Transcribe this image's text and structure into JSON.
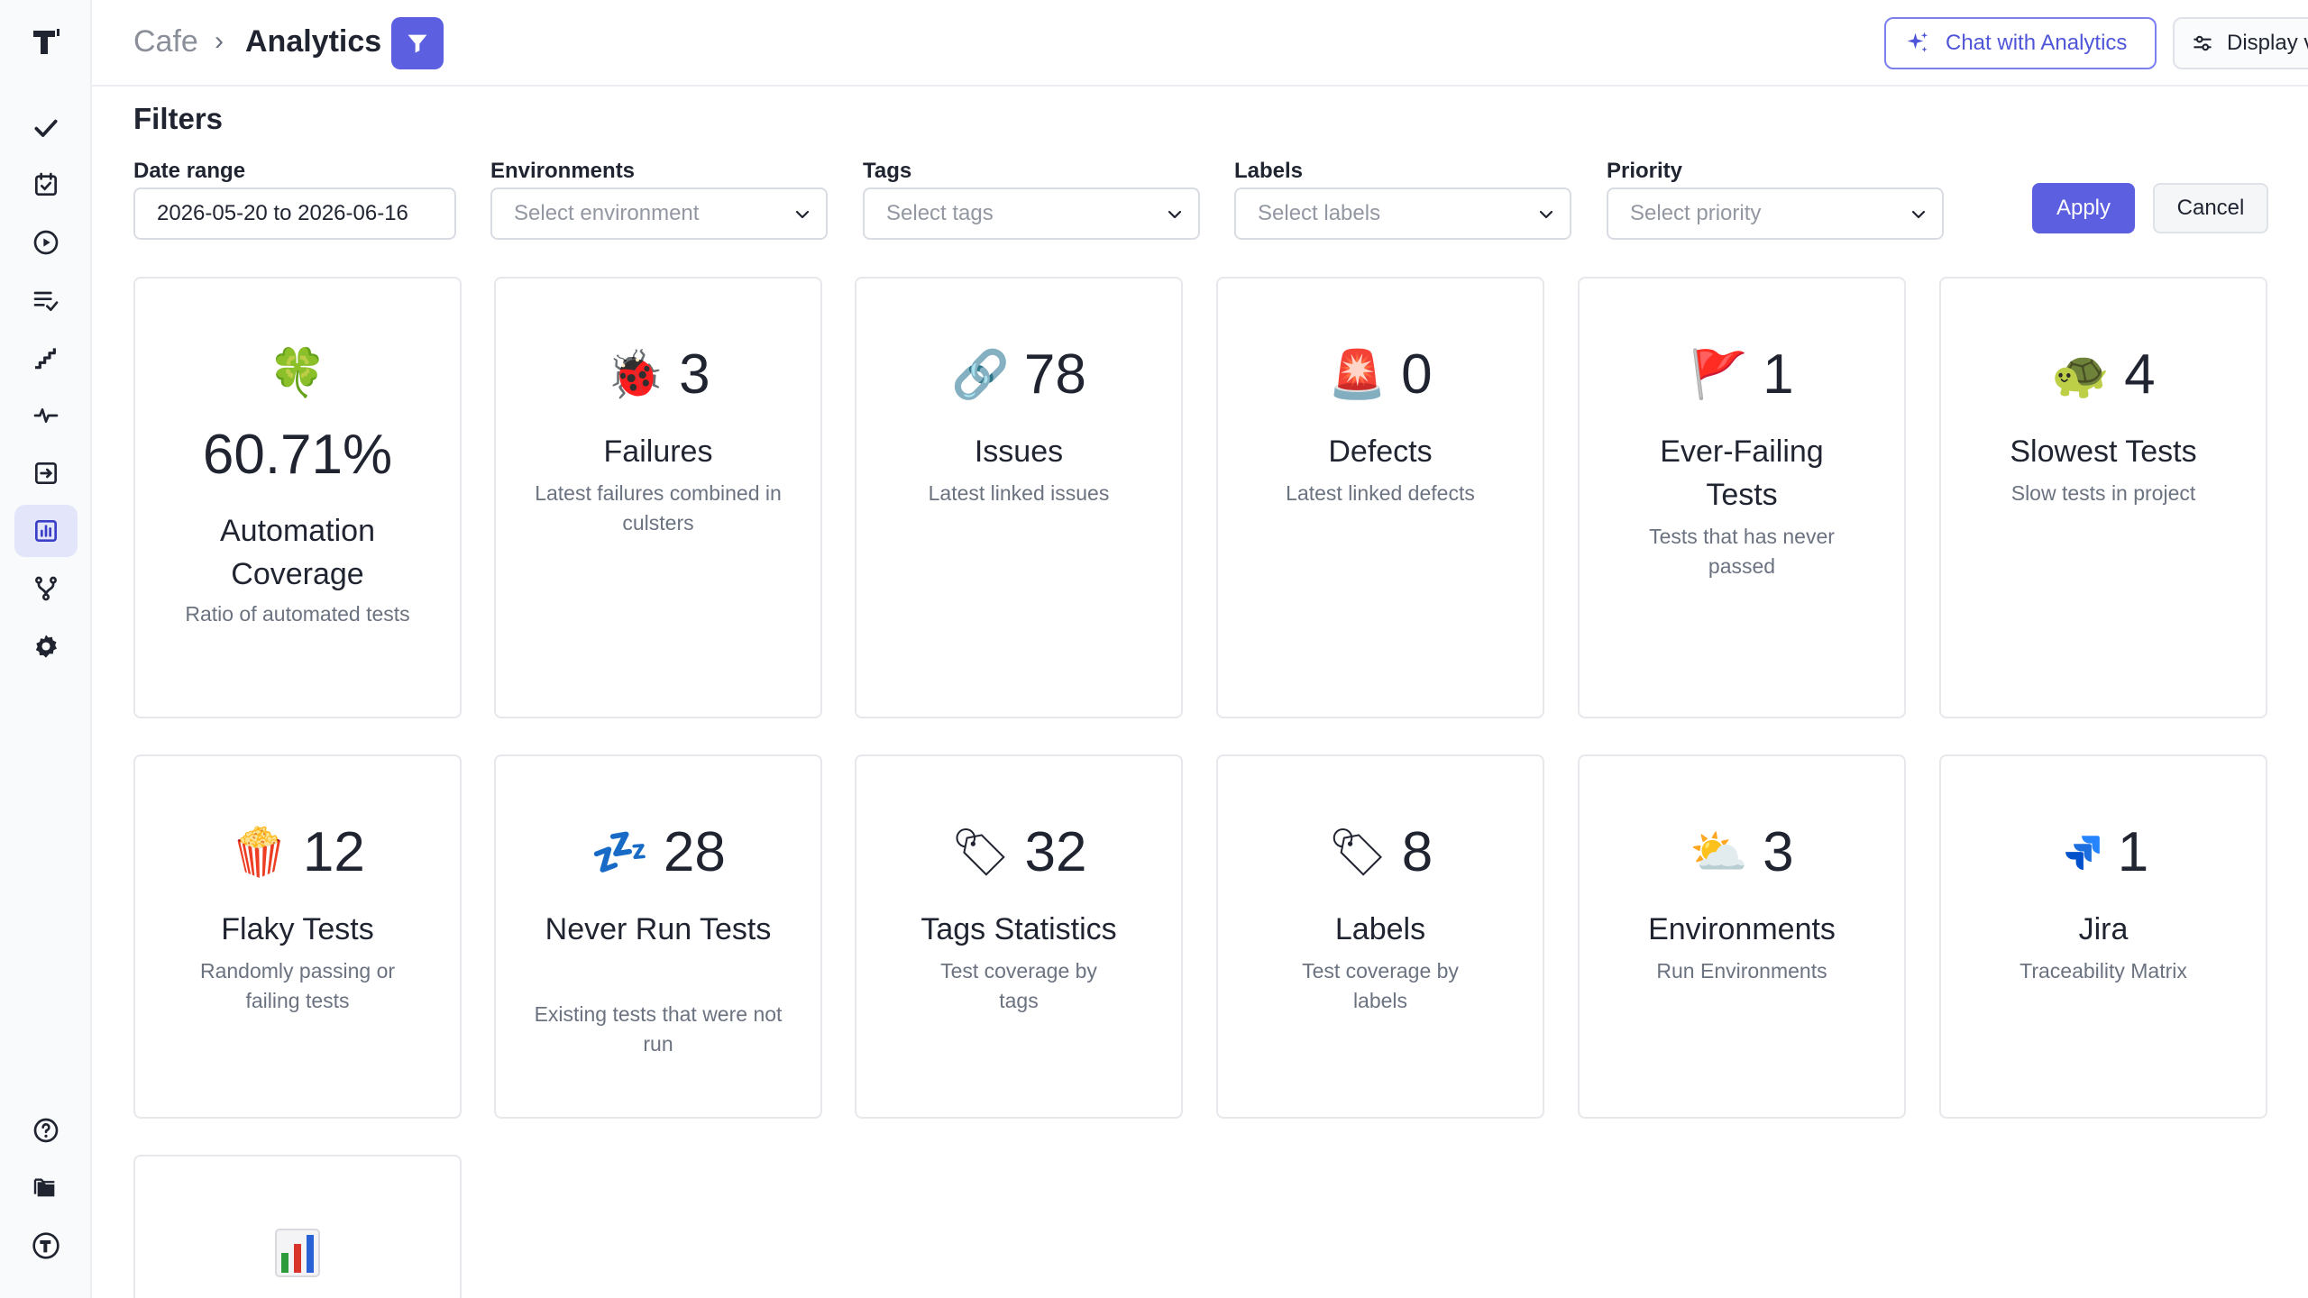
{
  "breadcrumb": {
    "project": "Cafe",
    "separator": "›",
    "page": "Analytics"
  },
  "header": {
    "chat_label": "Chat with Analytics",
    "display_label": "Display view"
  },
  "filters": {
    "title": "Filters",
    "date_range": {
      "label": "Date range",
      "value": "2026-05-20 to 2026-06-16"
    },
    "environments": {
      "label": "Environments",
      "placeholder": "Select environment"
    },
    "tags": {
      "label": "Tags",
      "placeholder": "Select tags"
    },
    "labels": {
      "label": "Labels",
      "placeholder": "Select labels"
    },
    "priority": {
      "label": "Priority",
      "placeholder": "Select priority"
    },
    "apply_label": "Apply",
    "cancel_label": "Cancel"
  },
  "cards": [
    {
      "id": "automation",
      "icon": "four-leaf-clover-icon",
      "emoji": "🍀",
      "value": "60.71%",
      "title": "Automation Coverage",
      "description": "Ratio of automated tests"
    },
    {
      "id": "failures",
      "icon": "ladybug-icon",
      "emoji": "🐞",
      "value": "3",
      "title": "Failures",
      "description": "Latest failures combined in culsters"
    },
    {
      "id": "issues",
      "icon": "link-icon",
      "emoji": "🔗",
      "value": "78",
      "title": "Issues",
      "description": "Latest linked issues"
    },
    {
      "id": "defects",
      "icon": "siren-icon",
      "emoji": "🚨",
      "value": "0",
      "title": "Defects",
      "description": "Latest linked defects"
    },
    {
      "id": "ever-failing",
      "icon": "red-flag-icon",
      "emoji": "🚩",
      "value": "1",
      "title": "Ever-Failing Tests",
      "description": "Tests that has never passed"
    },
    {
      "id": "slowest",
      "icon": "turtle-icon",
      "emoji": "🐢",
      "value": "4",
      "title": "Slowest Tests",
      "description": "Slow tests in project"
    },
    {
      "id": "flaky",
      "icon": "popcorn-icon",
      "emoji": "🍿",
      "value": "12",
      "title": "Flaky Tests",
      "description": "Randomly passing or failing tests"
    },
    {
      "id": "never-run",
      "icon": "sleep-zzz-icon",
      "emoji": "💤",
      "value": "28",
      "title": "Never Run Tests",
      "description": "Existing tests that were not run"
    },
    {
      "id": "tags",
      "icon": "tag-icon",
      "emoji": "🏷",
      "value": "32",
      "title": "Tags Statistics",
      "description": "Test coverage by tags"
    },
    {
      "id": "labels",
      "icon": "label-tag-icon",
      "emoji": "🏷",
      "value": "8",
      "title": "Labels",
      "description": "Test coverage by labels"
    },
    {
      "id": "environments",
      "icon": "sun-behind-cloud-icon",
      "emoji": "⛅",
      "value": "3",
      "title": "Environments",
      "description": "Run Environments"
    },
    {
      "id": "jira",
      "icon": "jira-icon",
      "emoji": "",
      "value": "1",
      "title": "Jira",
      "description": "Traceability Matrix"
    },
    {
      "id": "bar-chart",
      "icon": "bar-chart-icon",
      "emoji": "📊",
      "value": "",
      "title": "",
      "description": ""
    }
  ],
  "colors": {
    "accent": "#5b5fe0",
    "sidebar_active": "#e3e6fb",
    "border": "#e6e8ec"
  }
}
